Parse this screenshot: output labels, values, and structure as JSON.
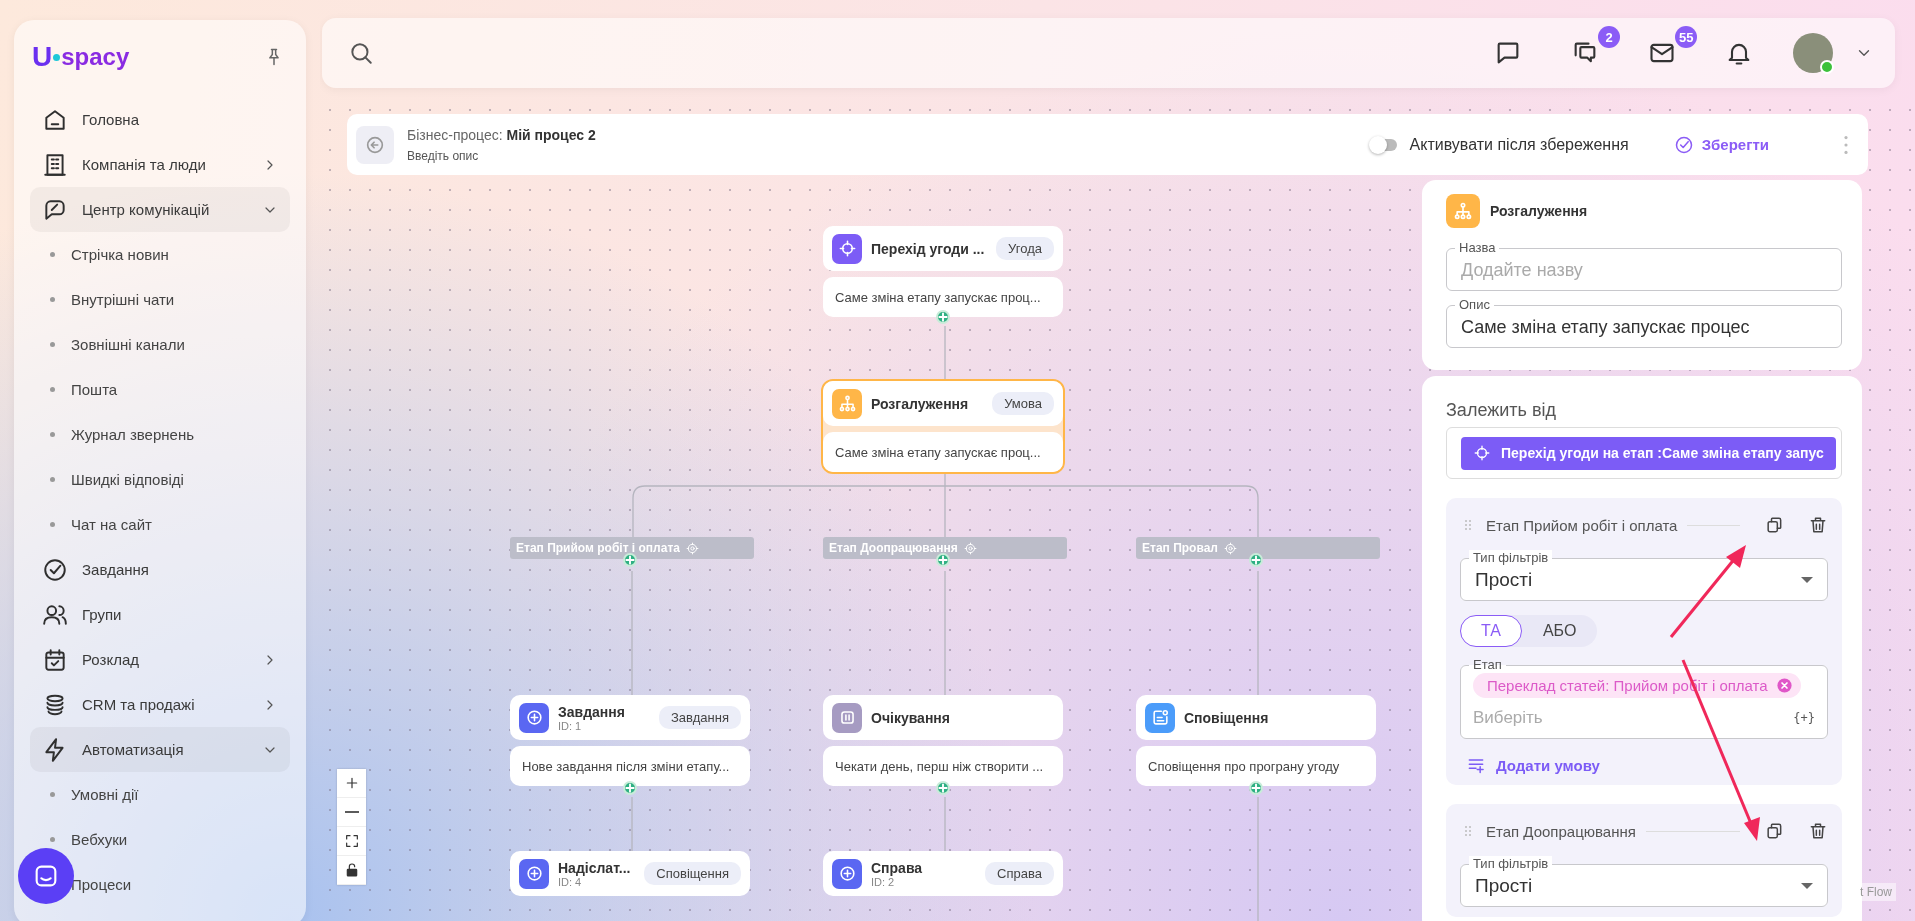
{
  "sidebar": {
    "logo_mark": "U",
    "logo_text": "spacy",
    "items": [
      {
        "label": "Головна"
      },
      {
        "label": "Компанія та люди",
        "expanded": false
      },
      {
        "label": "Центр комунікацій",
        "expanded": true,
        "children": [
          "Стрічка новин",
          "Внутрішні чати",
          "Зовнішні канали",
          "Пошта",
          "Журнал звернень",
          "Швидкі відповіді",
          "Чат на сайт"
        ]
      },
      {
        "label": "Завдання"
      },
      {
        "label": "Групи"
      },
      {
        "label": "Розклад",
        "expanded": false
      },
      {
        "label": "CRM та продажі",
        "expanded": false
      },
      {
        "label": "Автоматизація",
        "expanded": true,
        "children": [
          "Умовні дії",
          "Вебхуки",
          "Процеси"
        ]
      }
    ]
  },
  "topbar": {
    "actions": [
      {
        "kind": "chat"
      },
      {
        "kind": "messages",
        "badge": "2"
      },
      {
        "kind": "mail",
        "badge": "55"
      },
      {
        "kind": "bell"
      }
    ],
    "avatar": {
      "online": true
    }
  },
  "process_header": {
    "title": "Бізнес-процес: **Мій процес 2**",
    "description_placeholder": "Введіть опис",
    "activate": {
      "label": "Активувати після збереження",
      "on": false
    },
    "save_button": "Зберегти"
  },
  "flow": {
    "trigger": {
      "kind": "trigger",
      "title": "Перехід угоди ...",
      "tag": "Угода",
      "description": "Саме зміна етапу запускає проц...",
      "selected": false
    },
    "condition": {
      "kind": "condition",
      "title": "Розгалуження",
      "tag": "Умова",
      "description": "Саме зміна етапу запускає проц...",
      "selected": true
    },
    "branches": [
      {
        "label": "Етап Прийом робіт і оплата",
        "nodes": [
          {
            "kind": "action",
            "title": "Завдання",
            "id": "ID: 1",
            "tag": "Завдання",
            "description": "Нове завдання після зміни етапу...",
            "selected": false
          },
          {
            "kind": "action",
            "title": "Надіслат...",
            "id": "ID: 4",
            "tag": "Сповіщення",
            "selected": false
          }
        ]
      },
      {
        "label": "Етап Доопрацювання",
        "nodes": [
          {
            "kind": "wait",
            "title": "Очікування",
            "description": "Чекати день, перш ніж створити ...",
            "selected": false
          },
          {
            "kind": "action",
            "title": "Справа",
            "id": "ID: 2",
            "tag": "Справа",
            "selected": false
          }
        ]
      },
      {
        "label": "Етап Провал",
        "nodes": [
          {
            "kind": "notification",
            "title": "Сповіщення",
            "description": "Сповіщення про програну угоду",
            "selected": false
          }
        ]
      }
    ],
    "attribution": "t Flow"
  },
  "panel": {
    "title": "Розгалуження",
    "name_field": {
      "label": "Назва",
      "placeholder": "Додайте назву"
    },
    "description_field": {
      "label": "Опис",
      "value": "Саме зміна етапу запускає процес"
    },
    "depends_label": "Залежить від",
    "depends_chip": "Перехід угоди на етап :Саме зміна етапу запус",
    "conditions": [
      {
        "title": "Етап Прийом робіт і оплата",
        "filter_label": "Тип фільтрів",
        "filter_value": "Прості",
        "logic": [
          {
            "label": "ТА",
            "selected": true
          },
          {
            "label": "АБО",
            "selected": false
          }
        ],
        "stage_label": "Етап",
        "chips": [
          "Переклад статей: Прийом робіт і оплата"
        ],
        "stage_placeholder": "Виберіть",
        "insert_variable": "{+}",
        "add_button": "Додати умову"
      },
      {
        "title": "Етап Доопрацювання",
        "filter_label": "Тип фільтрів",
        "filter_value": "Прості"
      }
    ]
  }
}
